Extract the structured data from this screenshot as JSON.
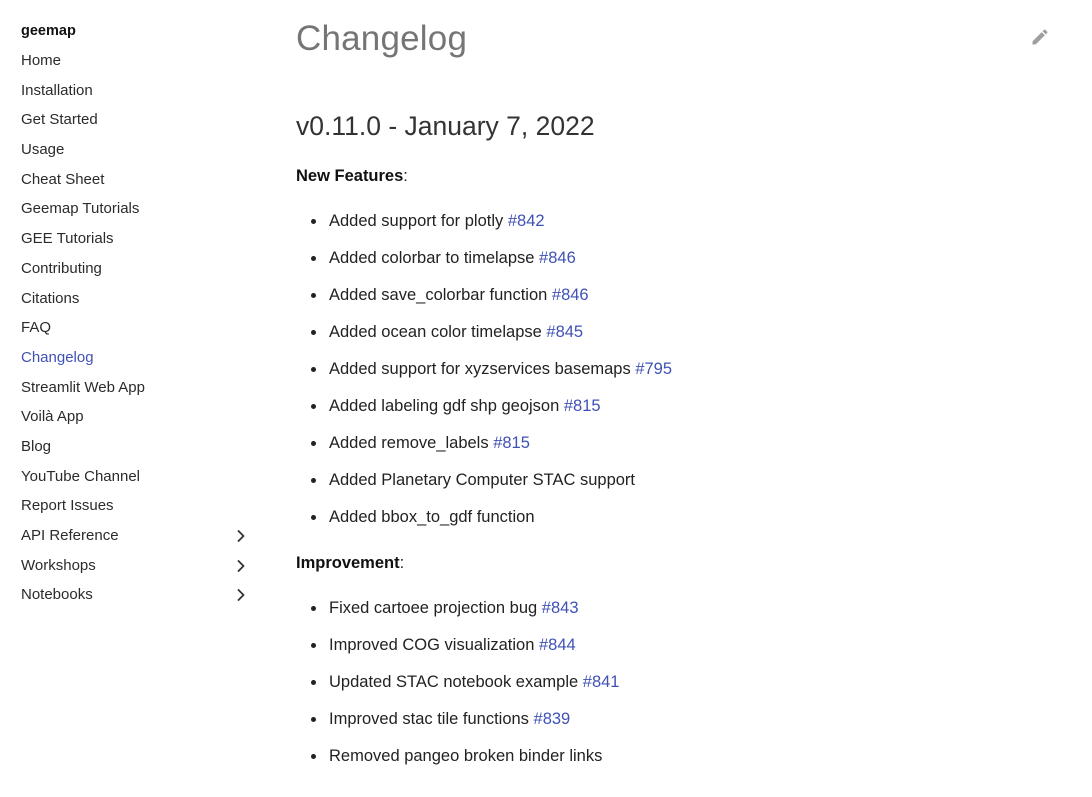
{
  "site": {
    "title": "geemap"
  },
  "sidebar": {
    "items": [
      {
        "label": "Home"
      },
      {
        "label": "Installation"
      },
      {
        "label": "Get Started"
      },
      {
        "label": "Usage"
      },
      {
        "label": "Cheat Sheet"
      },
      {
        "label": "Geemap Tutorials"
      },
      {
        "label": "GEE Tutorials"
      },
      {
        "label": "Contributing"
      },
      {
        "label": "Citations"
      },
      {
        "label": "FAQ"
      },
      {
        "label": "Changelog",
        "active": true
      },
      {
        "label": "Streamlit Web App"
      },
      {
        "label": "Voilà App"
      },
      {
        "label": "Blog"
      },
      {
        "label": "YouTube Channel"
      },
      {
        "label": "Report Issues"
      },
      {
        "label": "API Reference",
        "expandable": true
      },
      {
        "label": "Workshops",
        "expandable": true
      },
      {
        "label": "Notebooks",
        "expandable": true
      }
    ],
    "chevron_icon": "chevron-right-icon"
  },
  "header": {
    "edit_icon": "pencil-edit-icon"
  },
  "main": {
    "title": "Changelog",
    "version_heading": "v0.11.0 - January 7, 2022",
    "sections": [
      {
        "label": "New Features",
        "suffix": ":",
        "items": [
          {
            "text": "Added support for plotly ",
            "link": "#842"
          },
          {
            "text": "Added colorbar to timelapse ",
            "link": "#846"
          },
          {
            "text": "Added save_colorbar function ",
            "link": "#846"
          },
          {
            "text": "Added ocean color timelapse ",
            "link": "#845"
          },
          {
            "text": "Added support for xyzservices basemaps ",
            "link": "#795"
          },
          {
            "text": "Added labeling gdf shp geojson ",
            "link": "#815"
          },
          {
            "text": "Added remove_labels ",
            "link": "#815"
          },
          {
            "text": "Added Planetary Computer STAC support",
            "link": ""
          },
          {
            "text": "Added bbox_to_gdf function",
            "link": ""
          }
        ]
      },
      {
        "label": "Improvement",
        "suffix": ":",
        "items": [
          {
            "text": "Fixed cartoee projection bug ",
            "link": "#843"
          },
          {
            "text": "Improved COG visualization ",
            "link": "#844"
          },
          {
            "text": "Updated STAC notebook example ",
            "link": "#841"
          },
          {
            "text": "Improved stac tile functions ",
            "link": "#839"
          },
          {
            "text": "Removed pangeo broken binder links",
            "link": ""
          }
        ]
      }
    ]
  },
  "colors": {
    "accent": "#3f51b5",
    "title_gray": "#757575",
    "icon_gray": "#9e9e9e"
  }
}
